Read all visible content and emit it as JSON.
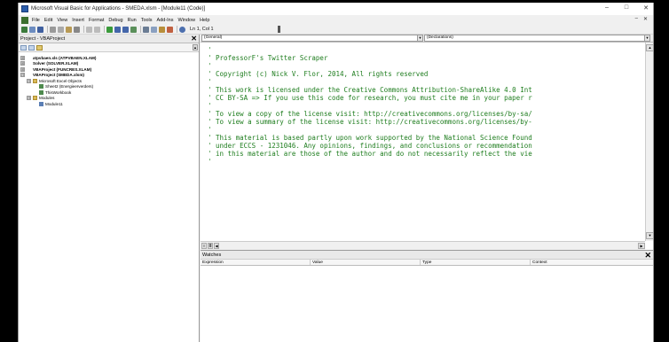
{
  "window": {
    "title": "Microsoft Visual Basic for Applications - SMEDA.xlsm - [Module11 (Code)]",
    "controls": [
      "–",
      "□",
      "✕"
    ]
  },
  "menu": {
    "items": [
      "File",
      "Edit",
      "View",
      "Insert",
      "Format",
      "Debug",
      "Run",
      "Tools",
      "Add-Ins",
      "Window",
      "Help"
    ],
    "right_controls": [
      "–",
      "✕"
    ]
  },
  "toolbar": {
    "position": "Ln 1, Col 1"
  },
  "project": {
    "title": "Project - VBAProject",
    "close": "✕",
    "tree": [
      {
        "toggle": "⊞",
        "icon": "project",
        "label": "atpvbaen.xls (ATPVBAEN.XLAM)",
        "bold": true,
        "indent": 0
      },
      {
        "toggle": "⊞",
        "icon": "project",
        "label": "Solver (SOLVER.XLAM)",
        "bold": true,
        "indent": 0
      },
      {
        "toggle": "⊞",
        "icon": "project",
        "label": "VBAProject (FUNCRES.XLAM)",
        "bold": true,
        "indent": 0
      },
      {
        "toggle": "⊟",
        "icon": "project",
        "label": "VBAProject (SMEDA.xlsm)",
        "bold": true,
        "indent": 0
      },
      {
        "toggle": "⊟",
        "icon": "folder",
        "label": "Microsoft Excel Objects",
        "bold": false,
        "indent": 1
      },
      {
        "toggle": "",
        "icon": "sheet",
        "label": "Sheet2 (Energieerverders)",
        "bold": false,
        "indent": 2
      },
      {
        "toggle": "",
        "icon": "sheet",
        "label": "ThisWorkbook",
        "bold": false,
        "indent": 2
      },
      {
        "toggle": "⊟",
        "icon": "folder",
        "label": "Modules",
        "bold": false,
        "indent": 1
      },
      {
        "toggle": "",
        "icon": "module",
        "label": "Module11",
        "bold": false,
        "indent": 2
      }
    ]
  },
  "code": {
    "object_dropdown": "(General)",
    "proc_dropdown": "(Declarations)",
    "lines": [
      "'",
      "' ProfessorF's Twitter Scraper",
      "'",
      "' Copyright (c) Nick V. Flor, 2014, All rights reserved",
      "'",
      "' This work is licensed under the Creative Commons Attribution-ShareAlike 4.0 Int",
      "' CC BY-SA => If you use this code for research, you must cite me in your paper r",
      "'",
      "' To view a copy of the license visit: http://creativecommons.org/licenses/by-sa/",
      "' To view a summary of the license visit: http://creativecommons.org/licenses/by-",
      "'",
      "' This material is based partly upon work supported by the National Science Found",
      "' under ECCS - 1231046. Any opinions, findings, and conclusions or recommendation",
      "' in this material are those of the author and do not necessarily reflect the vie",
      "'"
    ]
  },
  "watches": {
    "title": "Watches",
    "close": "✕",
    "columns": [
      "Expression",
      "Value",
      "Type",
      "Context"
    ]
  },
  "colors": {
    "comment_green": "#1e7d1e",
    "window_bg": "#f0f0f0"
  }
}
